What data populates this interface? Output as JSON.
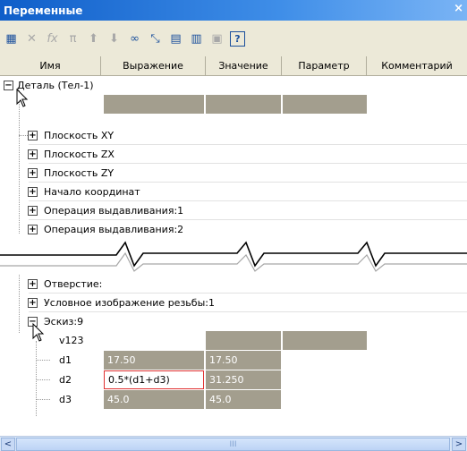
{
  "window": {
    "title": "Переменные",
    "close": "×"
  },
  "toolbar": {
    "icons": [
      "table-icon",
      "delete-icon",
      "function-icon",
      "pi-icon",
      "arrow-up-icon",
      "arrow-down-icon",
      "link-icon",
      "expand-icon",
      "page-icon",
      "grid-icon",
      "book-icon",
      "help-icon"
    ]
  },
  "columns": [
    "Имя",
    "Выражение",
    "Значение",
    "Параметр",
    "Комментарий"
  ],
  "tree": {
    "root": {
      "expander": "−",
      "label": "Деталь (Тел-1)"
    },
    "items_top": [
      {
        "expander": "+",
        "label": "Плоскость XY"
      },
      {
        "expander": "+",
        "label": "Плоскость ZX"
      },
      {
        "expander": "+",
        "label": "Плоскость ZY"
      },
      {
        "expander": "+",
        "label": "Начало координат"
      },
      {
        "expander": "+",
        "label": "Операция выдавливания:1"
      },
      {
        "expander": "+",
        "label": "Операция выдавливания:2"
      }
    ],
    "items_bottom": [
      {
        "expander": "+",
        "label": "Отверстие:"
      },
      {
        "expander": "+",
        "label": "Условное изображение резьбы:1"
      },
      {
        "expander": "−",
        "label": "Эскиз:9"
      }
    ],
    "variables": [
      {
        "name": "v123",
        "expression": "",
        "value": ""
      },
      {
        "name": "d1",
        "expression": "17.50",
        "value": "17.50"
      },
      {
        "name": "d2",
        "expression": "0.5*(d1+d3)",
        "value": "31.250"
      },
      {
        "name": "d3",
        "expression": "45.0",
        "value": "45.0"
      }
    ]
  },
  "scrollbar": {
    "left": "<",
    "right": ">",
    "thumb": "III"
  },
  "colors": {
    "title_bar": "#0f5ec9",
    "grey_cell": "#a39e8e",
    "highlight_border": "#e03030"
  }
}
